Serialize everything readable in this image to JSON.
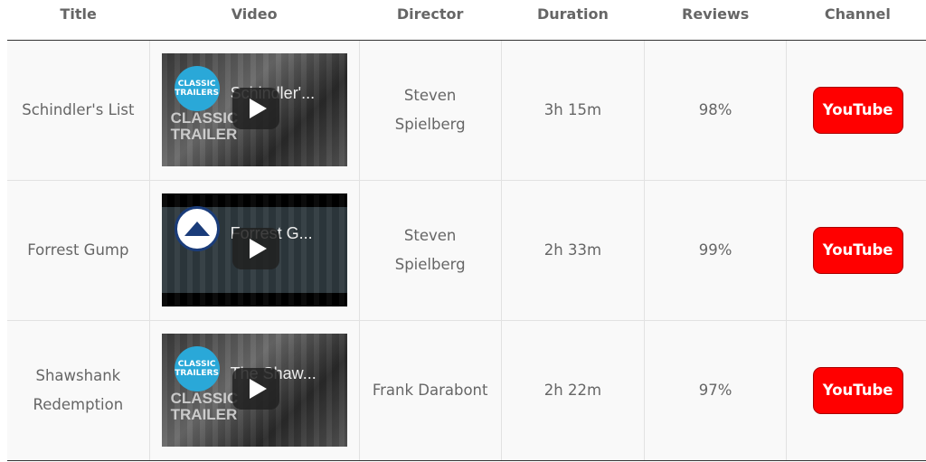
{
  "columns": [
    "Title",
    "Video",
    "Director",
    "Duration",
    "Reviews",
    "Channel"
  ],
  "rows": [
    {
      "title_lines": [
        "Schindler's List"
      ],
      "video": {
        "title": "Schindler'...",
        "badge_lines": [
          "CLASSIC",
          "TRAILERS"
        ],
        "watermark": [
          "CLASSIC",
          "TRAILER"
        ],
        "channel_icon": "classic-trailers-badge-icon"
      },
      "director_lines": [
        "Steven",
        "Spielberg"
      ],
      "duration": "3h 15m",
      "reviews": "98%",
      "channel_label": "YouTube"
    },
    {
      "title_lines": [
        "Forrest Gump"
      ],
      "video": {
        "title": "Forrest G...",
        "badge_lines": [],
        "watermark": [],
        "channel_icon": "paramount-logo-icon"
      },
      "director_lines": [
        "Steven",
        "Spielberg"
      ],
      "duration": "2h 33m",
      "reviews": "99%",
      "channel_label": "YouTube"
    },
    {
      "title_lines": [
        "Shawshank",
        "Redemption"
      ],
      "video": {
        "title": "The Shaw...",
        "badge_lines": [
          "CLASSIC",
          "TRAILERS"
        ],
        "watermark": [
          "CLASSIC",
          "TRAILER"
        ],
        "channel_icon": "classic-trailers-badge-icon"
      },
      "director_lines": [
        "Frank Darabont"
      ],
      "duration": "2h 22m",
      "reviews": "97%",
      "channel_label": "YouTube"
    }
  ],
  "colors": {
    "youtube_button": "#ff0000",
    "badge": "#2aa8d8"
  }
}
